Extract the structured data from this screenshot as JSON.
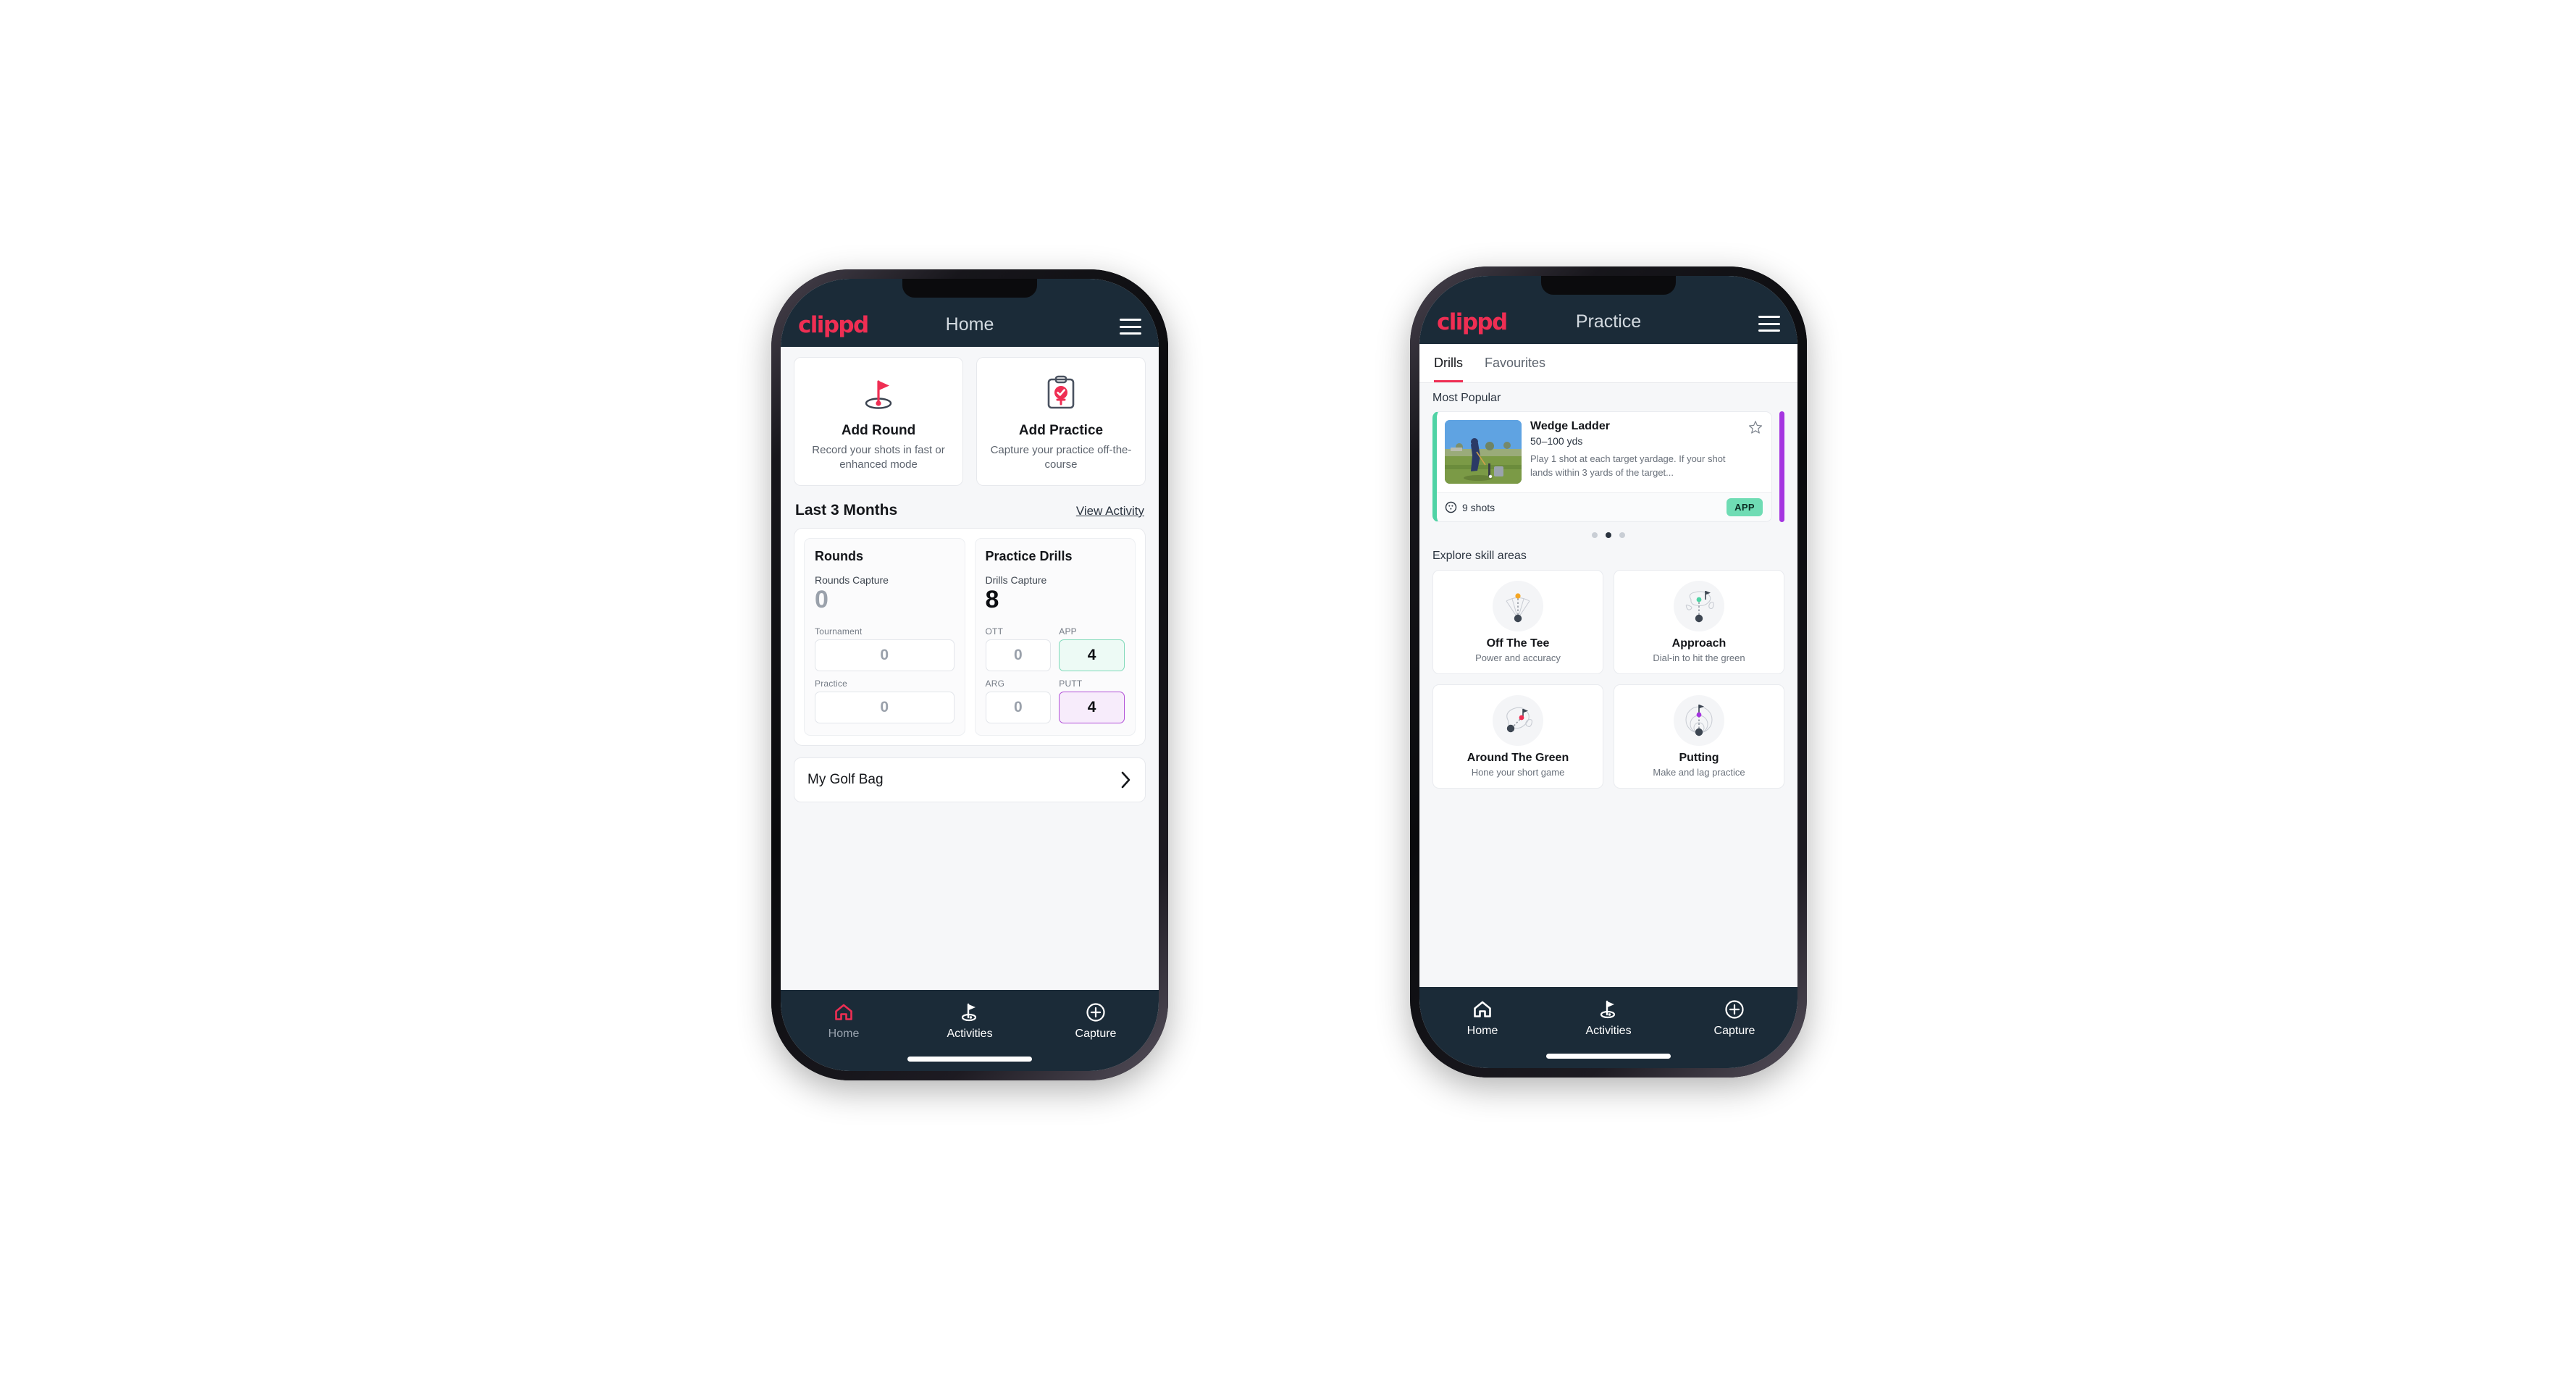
{
  "brand": {
    "logo_text": "clippd",
    "accent_pink": "#ef2e53",
    "navy": "#1b2b38",
    "teal": "#6fdcb4",
    "purple": "#a535e0"
  },
  "home_phone": {
    "appbar": {
      "title": "Home",
      "menu_icon": "hamburger-menu-icon"
    },
    "actions": [
      {
        "icon": "golf-flag-hole-icon",
        "title": "Add Round",
        "subtitle": "Record your shots in fast or enhanced mode"
      },
      {
        "icon": "clipboard-check-icon",
        "title": "Add Practice",
        "subtitle": "Capture your practice off-the-course"
      }
    ],
    "section": {
      "title": "Last 3 Months",
      "link": "View Activity"
    },
    "rounds": {
      "heading": "Rounds",
      "capture_label": "Rounds Capture",
      "capture_value": "0",
      "items": [
        {
          "label": "Tournament",
          "value": "0",
          "highlight": "none"
        },
        {
          "label": "Practice",
          "value": "0",
          "highlight": "none"
        }
      ]
    },
    "drills": {
      "heading": "Practice Drills",
      "capture_label": "Drills Capture",
      "capture_value": "8",
      "items": [
        {
          "label": "OTT",
          "value": "0",
          "highlight": "none"
        },
        {
          "label": "APP",
          "value": "4",
          "highlight": "app"
        },
        {
          "label": "ARG",
          "value": "0",
          "highlight": "none"
        },
        {
          "label": "PUTT",
          "value": "4",
          "highlight": "putt"
        }
      ]
    },
    "golf_bag": {
      "label": "My Golf Bag",
      "chevron_icon": "chevron-right-icon"
    },
    "bottom_nav": [
      {
        "label": "Home",
        "icon": "home-icon",
        "active": true
      },
      {
        "label": "Activities",
        "icon": "golf-flag-icon",
        "active": false
      },
      {
        "label": "Capture",
        "icon": "plus-circle-icon",
        "active": false
      }
    ]
  },
  "practice_phone": {
    "appbar": {
      "title": "Practice",
      "menu_icon": "hamburger-menu-icon"
    },
    "tabs": [
      {
        "label": "Drills",
        "active": true
      },
      {
        "label": "Favourites",
        "active": false
      }
    ],
    "most_popular_label": "Most Popular",
    "drill": {
      "name": "Wedge Ladder",
      "yardage": "50–100 yds",
      "description": "Play 1 shot at each target yardage. If your shot lands within 3 yards of the target...",
      "shots": "9 shots",
      "shots_icon": "golf-ball-icon",
      "badge": "APP",
      "star_icon": "star-outline-icon",
      "accent": "#4fd3a5",
      "next_card_accent": "#a535e0"
    },
    "carousel_dots": {
      "count": 3,
      "active_index": 1
    },
    "skill_section_label": "Explore skill areas",
    "skills": [
      {
        "title": "Off The Tee",
        "subtitle": "Power and accuracy",
        "icon": "tee-dispersion-icon",
        "dot_color": "#f5a623"
      },
      {
        "title": "Approach",
        "subtitle": "Dial-in to hit the green",
        "icon": "green-approach-icon",
        "dot_color": "#4fd3a5"
      },
      {
        "title": "Around The Green",
        "subtitle": "Hone your short game",
        "icon": "chip-green-icon",
        "dot_color": "#ef2e53"
      },
      {
        "title": "Putting",
        "subtitle": "Make and lag practice",
        "icon": "putting-rings-icon",
        "dot_color": "#a535e0"
      }
    ],
    "bottom_nav": [
      {
        "label": "Home",
        "icon": "home-icon",
        "active": false
      },
      {
        "label": "Activities",
        "icon": "golf-flag-icon",
        "active": true
      },
      {
        "label": "Capture",
        "icon": "plus-circle-icon",
        "active": false
      }
    ]
  }
}
